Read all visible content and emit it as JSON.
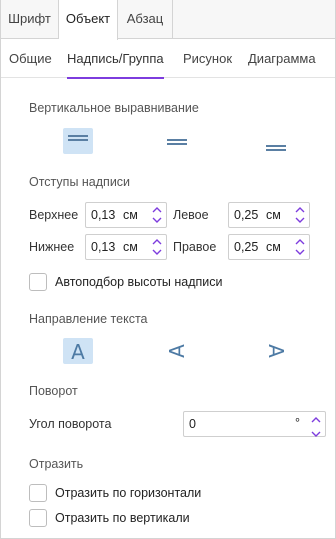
{
  "top_tabs": [
    "Шрифт",
    "Объект",
    "Абзац"
  ],
  "sub_tabs": [
    "Общие",
    "Надпись/Группа",
    "Рисунок",
    "Диаграмма"
  ],
  "vertical_align": {
    "title": "Вертикальное выравнивание",
    "options": [
      "top",
      "center",
      "bottom"
    ],
    "selected": "top"
  },
  "margins": {
    "title": "Отступы надписи",
    "top": {
      "label": "Верхнее",
      "value": "0,13",
      "unit": "см"
    },
    "bottom": {
      "label": "Нижнее",
      "value": "0,13",
      "unit": "см"
    },
    "left": {
      "label": "Левое",
      "value": "0,25",
      "unit": "см"
    },
    "right": {
      "label": "Правое",
      "value": "0,25",
      "unit": "см"
    }
  },
  "autofit": {
    "label": "Автоподбор высоты надписи",
    "checked": false
  },
  "text_direction": {
    "title": "Направление текста",
    "options": [
      "horizontal",
      "rotate-90",
      "rotate-270"
    ],
    "selected": "horizontal",
    "glyph": "A"
  },
  "rotation": {
    "title": "Поворот",
    "label": "Угол поворота",
    "value": "0",
    "unit": "°"
  },
  "flip": {
    "title": "Отразить",
    "horizontal": {
      "label": "Отразить по горизонтали",
      "checked": false
    },
    "vertical": {
      "label": "Отразить по вертикали",
      "checked": false
    }
  },
  "colors": {
    "accent": "#7d3cde",
    "selected_bg": "#cfe3f5",
    "icon": "#5a7fa3"
  },
  "icons": {
    "spin_up": "chevron-up-icon",
    "spin_down": "chevron-down-icon"
  }
}
